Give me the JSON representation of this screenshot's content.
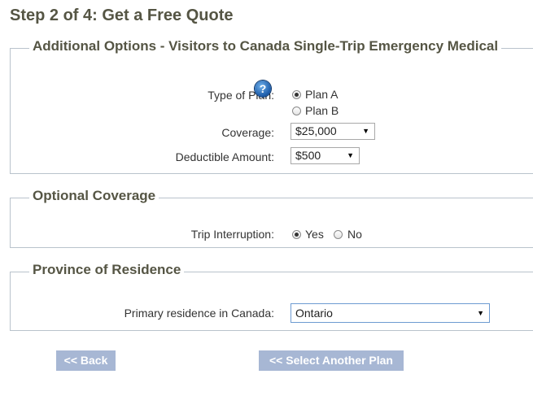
{
  "page": {
    "title": "Step 2 of 4: Get a Free Quote"
  },
  "additional_options": {
    "legend": "Additional Options - Visitors to Canada Single-Trip Emergency Medical",
    "plan_type_label": "Type of Plan:",
    "help_icon": "question-help-icon",
    "plans": [
      {
        "label": "Plan A",
        "checked": true
      },
      {
        "label": "Plan B",
        "checked": false
      }
    ],
    "coverage_label": "Coverage:",
    "coverage_value": "$25,000",
    "deductible_label": "Deductible Amount:",
    "deductible_value": "$500"
  },
  "optional_coverage": {
    "legend": "Optional Coverage",
    "trip_interruption_label": "Trip Interruption:",
    "options": [
      {
        "label": "Yes",
        "checked": true
      },
      {
        "label": "No",
        "checked": false
      }
    ]
  },
  "residence": {
    "legend": "Province of Residence",
    "label": "Primary residence in Canada:",
    "value": "Ontario"
  },
  "buttons": {
    "back": "<< Back",
    "select_another": "<< Select Another Plan"
  },
  "colors": {
    "button_bg": "#a7b7d4",
    "heading": "#555544",
    "border": "#b9c3cc"
  }
}
